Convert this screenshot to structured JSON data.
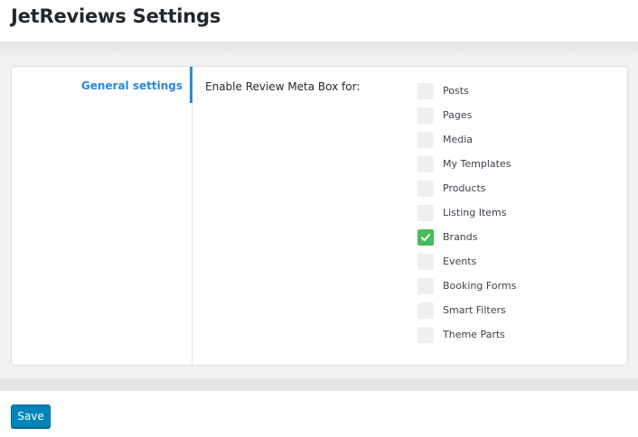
{
  "page": {
    "title": "JetReviews Settings"
  },
  "sidebar": {
    "items": [
      {
        "label": "General settings",
        "active": true
      }
    ]
  },
  "settings": {
    "field_label": "Enable Review Meta Box for:",
    "options": [
      {
        "label": "Posts",
        "checked": false
      },
      {
        "label": "Pages",
        "checked": false
      },
      {
        "label": "Media",
        "checked": false
      },
      {
        "label": "My Templates",
        "checked": false
      },
      {
        "label": "Products",
        "checked": false
      },
      {
        "label": "Listing Items",
        "checked": false
      },
      {
        "label": "Brands",
        "checked": true
      },
      {
        "label": "Events",
        "checked": false
      },
      {
        "label": "Booking Forms",
        "checked": false
      },
      {
        "label": "Smart Filters",
        "checked": false
      },
      {
        "label": "Theme Parts",
        "checked": false
      }
    ]
  },
  "actions": {
    "save_label": "Save"
  },
  "colors": {
    "accent": "#2b88d8",
    "checked": "#45bd5b",
    "button": "#0085ba"
  },
  "icons": {
    "check": "check-icon"
  }
}
